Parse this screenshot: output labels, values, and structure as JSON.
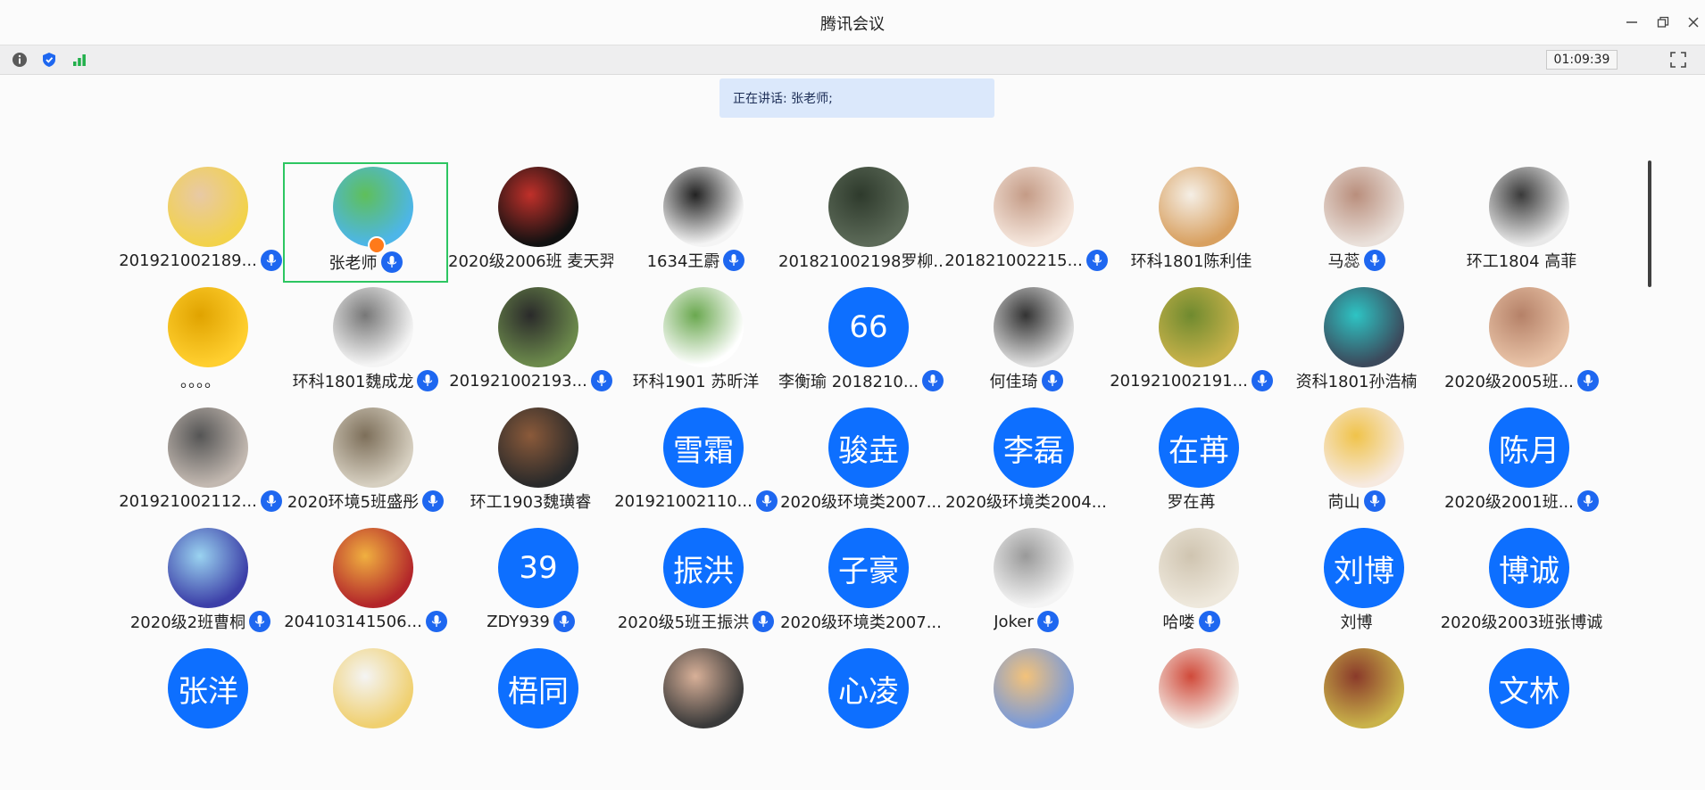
{
  "window": {
    "title": "腾讯会议",
    "controls": [
      "minimize-icon",
      "restore-icon",
      "close-icon"
    ]
  },
  "toolbar": {
    "icons": [
      "info-icon",
      "shield-icon",
      "signal-icon"
    ],
    "timer": "01:09:39",
    "fullscreen_icon": "fullscreen-icon"
  },
  "speaking_banner": "正在讲话: 张老师;",
  "colors": {
    "accent": "#0d6fff",
    "active_border": "#2dc661",
    "banner_bg": "#dbe8fb",
    "mic_bg": "#1e67f0"
  },
  "participants": [
    {
      "name": "201921002189...",
      "avatar": "photo",
      "mic": true
    },
    {
      "name": "张老师",
      "avatar": "photo",
      "mic": true,
      "active": true,
      "host": true
    },
    {
      "name": "2020级2006班 麦天羿",
      "avatar": "photo",
      "mic": false
    },
    {
      "name": "1634王霨",
      "avatar": "photo",
      "mic": true
    },
    {
      "name": "201821002198罗柳...",
      "avatar": "photo",
      "mic": false
    },
    {
      "name": "201821002215...",
      "avatar": "photo",
      "mic": true
    },
    {
      "name": "环科1801陈利佳",
      "avatar": "photo",
      "mic": false
    },
    {
      "name": "马蕊",
      "avatar": "photo",
      "mic": true
    },
    {
      "name": "环工1804 高菲",
      "avatar": "photo",
      "mic": false
    },
    {
      "name": "。。。。",
      "avatar": "photo",
      "mic": false
    },
    {
      "name": "环科1801魏成龙",
      "avatar": "photo",
      "mic": true
    },
    {
      "name": "201921002193...",
      "avatar": "photo",
      "mic": true
    },
    {
      "name": "环科1901 苏昕洋",
      "avatar": "photo",
      "mic": false
    },
    {
      "name": "李衡瑜 2018210...",
      "avatar": "66",
      "mic": true
    },
    {
      "name": "何佳琦",
      "avatar": "photo",
      "mic": true
    },
    {
      "name": "201921002191...",
      "avatar": "photo",
      "mic": true
    },
    {
      "name": "资科1801孙浩楠",
      "avatar": "photo",
      "mic": false
    },
    {
      "name": "2020级2005班...",
      "avatar": "photo",
      "mic": true
    },
    {
      "name": "201921002112...",
      "avatar": "photo",
      "mic": true
    },
    {
      "name": "2020环境5班盛彤",
      "avatar": "photo",
      "mic": true
    },
    {
      "name": "环工1903魏璜睿",
      "avatar": "photo",
      "mic": false
    },
    {
      "name": "201921002110...",
      "avatar": "雪霜",
      "mic": true
    },
    {
      "name": "2020级环境类2007...",
      "avatar": "骏垚",
      "mic": false
    },
    {
      "name": "2020级环境类2004...",
      "avatar": "李磊",
      "mic": false
    },
    {
      "name": "罗在苒",
      "avatar": "在苒",
      "mic": false
    },
    {
      "name": "苘山",
      "avatar": "photo",
      "mic": true
    },
    {
      "name": "2020级2001班...",
      "avatar": "陈月",
      "mic": true
    },
    {
      "name": "2020级2班曹桐",
      "avatar": "photo",
      "mic": true
    },
    {
      "name": "204103141506...",
      "avatar": "photo",
      "mic": true
    },
    {
      "name": "ZDY939",
      "avatar": "39",
      "mic": true
    },
    {
      "name": "2020级5班王振洪",
      "avatar": "振洪",
      "mic": true
    },
    {
      "name": "2020级环境类2007...",
      "avatar": "子豪",
      "mic": false
    },
    {
      "name": "Joker",
      "avatar": "photo",
      "mic": true
    },
    {
      "name": "哈喽",
      "avatar": "photo",
      "mic": true
    },
    {
      "name": "刘博",
      "avatar": "刘博",
      "mic": false
    },
    {
      "name": "2020级2003班张博诚",
      "avatar": "博诚",
      "mic": false
    },
    {
      "name": "",
      "avatar": "张洋",
      "mic": false
    },
    {
      "name": "",
      "avatar": "photo",
      "mic": false
    },
    {
      "name": "",
      "avatar": "梧同",
      "mic": false
    },
    {
      "name": "",
      "avatar": "photo",
      "mic": false
    },
    {
      "name": "",
      "avatar": "心凌",
      "mic": false
    },
    {
      "name": "",
      "avatar": "photo",
      "mic": false
    },
    {
      "name": "",
      "avatar": "photo",
      "mic": false
    },
    {
      "name": "",
      "avatar": "photo",
      "mic": false
    },
    {
      "name": "",
      "avatar": "文林",
      "mic": false
    }
  ]
}
